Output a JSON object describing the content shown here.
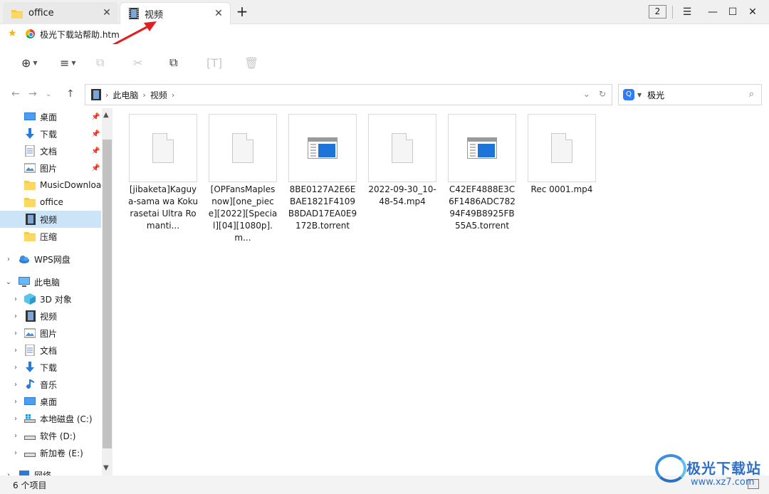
{
  "tabs": [
    {
      "label": "office",
      "icon": "folder-icon",
      "active": false
    },
    {
      "label": "视频",
      "icon": "video-folder-icon",
      "active": true
    }
  ],
  "window": {
    "count": "2",
    "menu_icon": "menu-icon",
    "minimize_icon": "minimize-icon",
    "maximize_icon": "maximize-icon",
    "close_icon": "close-icon"
  },
  "bookmark": {
    "label": "极光下载站帮助.htm"
  },
  "toolbar": {
    "new_icon": "add-circle-icon",
    "view_icon": "list-view-icon",
    "copy_icon": "copy-icon",
    "cut_icon": "cut-icon",
    "paste_icon": "paste-icon",
    "rename_icon": "rename-icon",
    "delete_icon": "delete-icon"
  },
  "address": {
    "crumbs": [
      "此电脑",
      "视频"
    ]
  },
  "search": {
    "value": "极光"
  },
  "sidebar": {
    "quick": [
      {
        "label": "桌面",
        "pinned": true
      },
      {
        "label": "下载",
        "pinned": true
      },
      {
        "label": "文档",
        "pinned": true
      },
      {
        "label": "图片",
        "pinned": true
      },
      {
        "label": "MusicDownload",
        "pinned": false
      },
      {
        "label": "office",
        "pinned": false
      },
      {
        "label": "视频",
        "pinned": false,
        "selected": true
      },
      {
        "label": "压缩",
        "pinned": false
      }
    ],
    "wps": "WPS网盘",
    "pc": "此电脑",
    "pc_items": [
      "3D 对象",
      "视频",
      "图片",
      "文档",
      "下载",
      "音乐",
      "桌面",
      "本地磁盘 (C:)",
      "软件 (D:)",
      "新加卷 (E:)"
    ],
    "network": "网络"
  },
  "files": [
    {
      "name": "[jibaketa]Kaguya-sama wa Kokurasetai Ultra Romanti...",
      "type": "doc"
    },
    {
      "name": "[OPFansMaplesnow][one_piece][2022][Special][04][1080p].m...",
      "type": "doc"
    },
    {
      "name": "8BE0127A2E6EBAE1821F4109B8DAD17EA0E9172B.torrent",
      "type": "app"
    },
    {
      "name": "2022-09-30_10-48-54.mp4",
      "type": "doc"
    },
    {
      "name": "C42EF4888E3C6F1486ADC78294F49B8925FB55A5.torrent",
      "type": "app"
    },
    {
      "name": "Rec 0001.mp4",
      "type": "doc"
    }
  ],
  "status": {
    "count": "6 个项目"
  },
  "watermark": {
    "title": "极光下载站",
    "url": "www.xz7.com"
  },
  "colors": {
    "selection": "#cce4f7",
    "accent": "#1e74d8",
    "arrow": "#e02020"
  }
}
